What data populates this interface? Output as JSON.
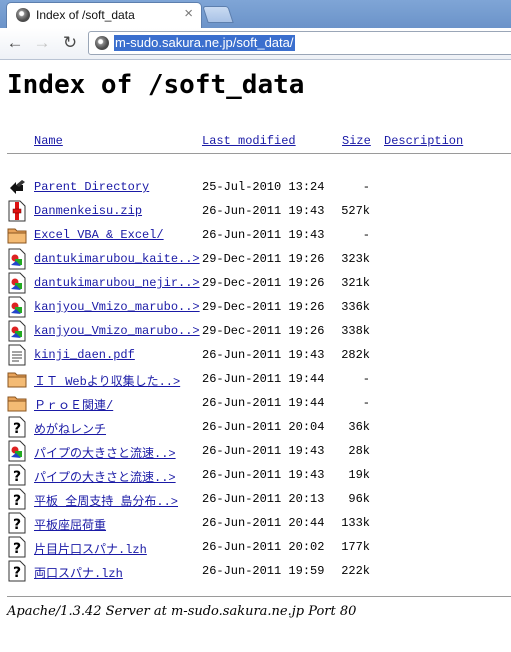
{
  "tab": {
    "title": "Index of /soft_data"
  },
  "address_bar": {
    "url": "m-sudo.sakura.ne.jp/soft_data/"
  },
  "page": {
    "heading": "Index of /soft_data",
    "columns": {
      "name": "Name",
      "last_modified": "Last modified",
      "size": "Size",
      "description": "Description"
    },
    "rows": [
      {
        "icon": "back-arrow-icon",
        "name": "Parent Directory",
        "date": "25-Jul-2010 13:24",
        "size": "-"
      },
      {
        "icon": "compressed-file-icon",
        "name": "Danmenkeisu.zip",
        "date": "26-Jun-2011 19:43",
        "size": "527k"
      },
      {
        "icon": "folder-icon",
        "name": "Excel VBA & Excel/",
        "date": "26-Jun-2011 19:43",
        "size": "-"
      },
      {
        "icon": "image-file-icon",
        "name": "dantukimarubou_kaite..>",
        "date": "29-Dec-2011 19:26",
        "size": "323k"
      },
      {
        "icon": "image-file-icon",
        "name": "dantukimarubou_nejir..>",
        "date": "29-Dec-2011 19:26",
        "size": "321k"
      },
      {
        "icon": "image-file-icon",
        "name": "kanjyou_Vmizo_marubo..>",
        "date": "29-Dec-2011 19:26",
        "size": "336k"
      },
      {
        "icon": "image-file-icon",
        "name": "kanjyou_Vmizo_marubo..>",
        "date": "29-Dec-2011 19:26",
        "size": "338k"
      },
      {
        "icon": "document-file-icon",
        "name": "kinji_daen.pdf",
        "date": "26-Jun-2011 19:43",
        "size": "282k"
      },
      {
        "icon": "folder-icon",
        "name": "ＩＴ Webより収集した..>",
        "date": "26-Jun-2011 19:44",
        "size": "-"
      },
      {
        "icon": "folder-icon",
        "name": "ＰｒｏＥ関連/",
        "date": "26-Jun-2011 19:44",
        "size": "-"
      },
      {
        "icon": "unknown-file-icon",
        "name": "めがねレンチ",
        "date": "26-Jun-2011 20:04",
        "size": "36k"
      },
      {
        "icon": "image-file-icon",
        "name": "パイプの大きさと流速..>",
        "date": "26-Jun-2011 19:43",
        "size": "28k"
      },
      {
        "icon": "unknown-file-icon",
        "name": "パイプの大きさと流速..>",
        "date": "26-Jun-2011 19:43",
        "size": "19k"
      },
      {
        "icon": "unknown-file-icon",
        "name": "平板 全周支持 島分布..>",
        "date": "26-Jun-2011 20:13",
        "size": "96k"
      },
      {
        "icon": "unknown-file-icon",
        "name": "平板座屈荷重",
        "date": "26-Jun-2011 20:44",
        "size": "133k"
      },
      {
        "icon": "unknown-file-icon",
        "name": "片目片口スパナ.lzh",
        "date": "26-Jun-2011 20:02",
        "size": "177k"
      },
      {
        "icon": "unknown-file-icon",
        "name": "両口スパナ.lzh",
        "date": "26-Jun-2011 19:59",
        "size": "222k"
      }
    ],
    "footer": "Apache/1.3.42 Server at m-sudo.sakura.ne.jp Port 80"
  },
  "colors": {
    "link": "#1a1aa6",
    "tabstrip": "#6b93c9",
    "selection": "#3b6fce"
  }
}
